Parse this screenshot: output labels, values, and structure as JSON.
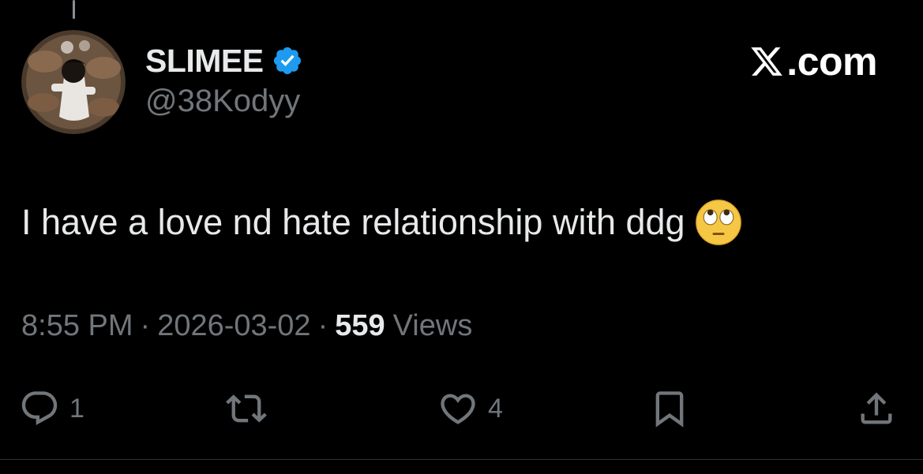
{
  "author": {
    "display_name": "SLIMEE",
    "handle": "@38Kodyy",
    "verified": true,
    "verified_color": "#1d9bf0",
    "avatar_icon": "profile-photo"
  },
  "brand": {
    "logo_icon": "x-logo",
    "text": ".com"
  },
  "tweet": {
    "text": "I have a love nd hate relationship with ddg",
    "emoji": "face-with-rolling-eyes"
  },
  "meta": {
    "time": "8:55 PM",
    "separator": "·",
    "date": "2026-03-02",
    "views_count": "559",
    "views_label": "Views"
  },
  "actions": {
    "reply": {
      "icon": "reply-bubble-icon",
      "count": "1"
    },
    "retweet": {
      "icon": "retweet-icon",
      "count": ""
    },
    "like": {
      "icon": "heart-icon",
      "count": "4"
    },
    "bookmark": {
      "icon": "bookmark-icon",
      "count": ""
    },
    "share": {
      "icon": "share-icon",
      "count": ""
    }
  },
  "colors": {
    "background": "#000000",
    "primary_text": "#e7e9ea",
    "secondary_text": "#71767b",
    "accent": "#1d9bf0"
  }
}
